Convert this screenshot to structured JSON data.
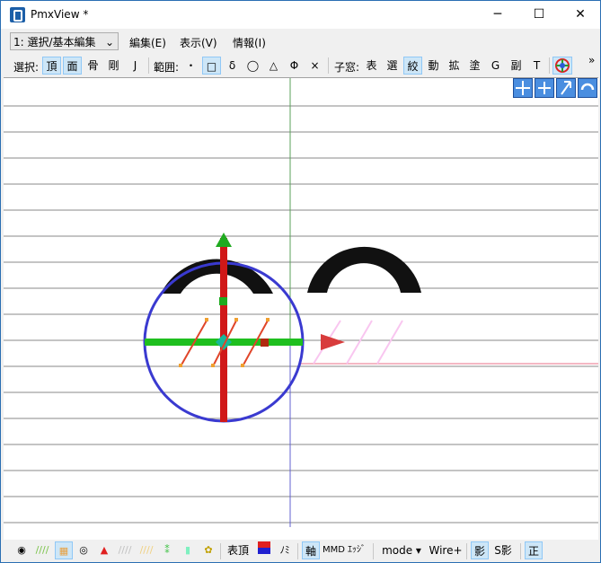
{
  "window": {
    "title": "PmxView *",
    "minimize": "─",
    "maximize": "☐",
    "close": "✕"
  },
  "menu": {
    "mode_selected": "1: 選択/基本編集",
    "edit": "編集(E)",
    "view": "表示(V)",
    "info": "情報(I)"
  },
  "toolbar": {
    "select_label": "選択:",
    "select_items": [
      "頂",
      "面",
      "骨",
      "剛",
      "J"
    ],
    "range_label": "範囲:",
    "range_items": [
      "・",
      "□",
      "δ",
      "◯",
      "△",
      "Φ",
      "×"
    ],
    "child_label": "子窓:",
    "child_items": [
      "表",
      "選",
      "絞",
      "動",
      "拡",
      "塗",
      "G",
      "副",
      "T"
    ],
    "overflow": "»"
  },
  "status": {
    "vertex_label": "表頂",
    "mini_label": "ﾉﾐ",
    "axis_label": "軸",
    "mmd_label": "MMD",
    "edge_label": "ｴｯｼﾞ",
    "mode_label": "mode",
    "wire_label": "Wire+",
    "shadow_label": "影",
    "sshadow_label": "S影",
    "front_label": "正"
  }
}
